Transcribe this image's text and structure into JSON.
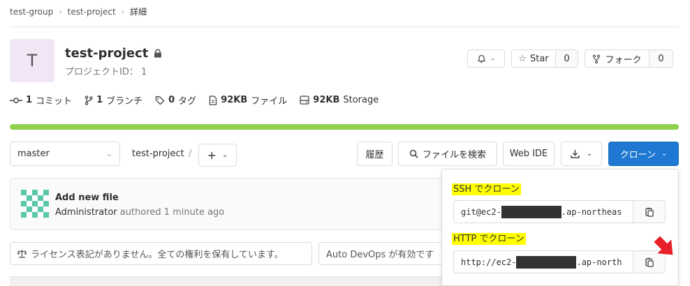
{
  "breadcrumb": {
    "group": "test-group",
    "project": "test-project",
    "current": "詳細"
  },
  "project": {
    "avatar_letter": "T",
    "name": "test-project",
    "id_label": "プロジェクトID： 1"
  },
  "actions": {
    "star_label": "Star",
    "star_count": "0",
    "fork_label": "フォーク",
    "fork_count": "0"
  },
  "stats": [
    {
      "icon": "commit-icon",
      "count": "1",
      "label": "コミット"
    },
    {
      "icon": "branch-icon",
      "count": "1",
      "label": "ブランチ"
    },
    {
      "icon": "tag-icon",
      "count": "0",
      "label": "タグ"
    },
    {
      "icon": "file-icon",
      "count": "92KB",
      "label": "ファイル"
    },
    {
      "icon": "storage-icon",
      "count": "92KB",
      "label": "Storage"
    }
  ],
  "progress": {
    "fraction": 1.0,
    "color": "#8fd14f"
  },
  "repo": {
    "branch": "master",
    "path": "test-project",
    "path_sep": "/",
    "history_label": "履歴",
    "find_file_label": "ファイルを検索",
    "web_ide_label": "Web IDE",
    "clone_label": "クローン"
  },
  "commit": {
    "title": "Add new file",
    "author": "Administrator",
    "meta": "authored 1 minute ago"
  },
  "info": {
    "license": "ライセンス表記がありません。全ての権利を保有しています。",
    "autodevops": "Auto DevOps が有効です"
  },
  "clone": {
    "ssh_title": "SSH でクローン",
    "ssh_prefix": "git@ec2-",
    "ssh_suffix": ".ap-northeas",
    "http_title": "HTTP でクローン",
    "http_prefix": "http://ec2-",
    "http_suffix": ".ap-north"
  },
  "colors": {
    "accent": "#1f78d1",
    "highlight": "#ffff00",
    "arrow": "#e8202a"
  }
}
